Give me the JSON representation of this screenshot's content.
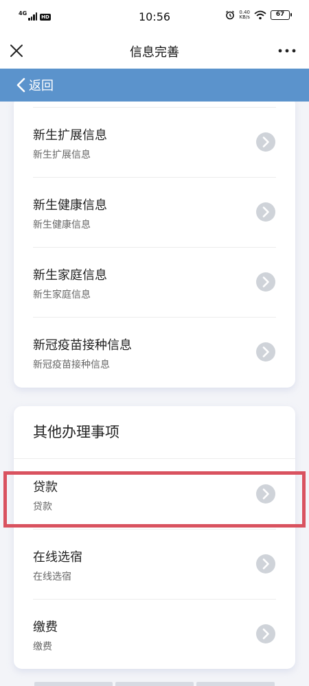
{
  "status_bar": {
    "network": "4G",
    "hd_badge": "HD",
    "time": "10:56",
    "speed_value": "0.40",
    "speed_unit": "KB/s",
    "battery": "67"
  },
  "title_bar": {
    "title": "信息完善",
    "close_icon": "close-icon",
    "more_icon": "more-icon"
  },
  "nav": {
    "back_label": "返回",
    "color": "#5b93cc"
  },
  "section_one": {
    "items": [
      {
        "title": "新生扩展信息",
        "subtitle": "新生扩展信息"
      },
      {
        "title": "新生健康信息",
        "subtitle": "新生健康信息"
      },
      {
        "title": "新生家庭信息",
        "subtitle": "新生家庭信息"
      },
      {
        "title": "新冠疫苗接种信息",
        "subtitle": "新冠疫苗接种信息"
      }
    ]
  },
  "section_two": {
    "title": "其他办理事项",
    "items": [
      {
        "title": "贷款",
        "subtitle": "贷款",
        "highlighted": true
      },
      {
        "title": "在线选宿",
        "subtitle": "在线选宿"
      },
      {
        "title": "缴费",
        "subtitle": "缴费"
      }
    ]
  },
  "colors": {
    "highlight": "#d9525f",
    "chevron_circle": "#cfd3d9"
  }
}
